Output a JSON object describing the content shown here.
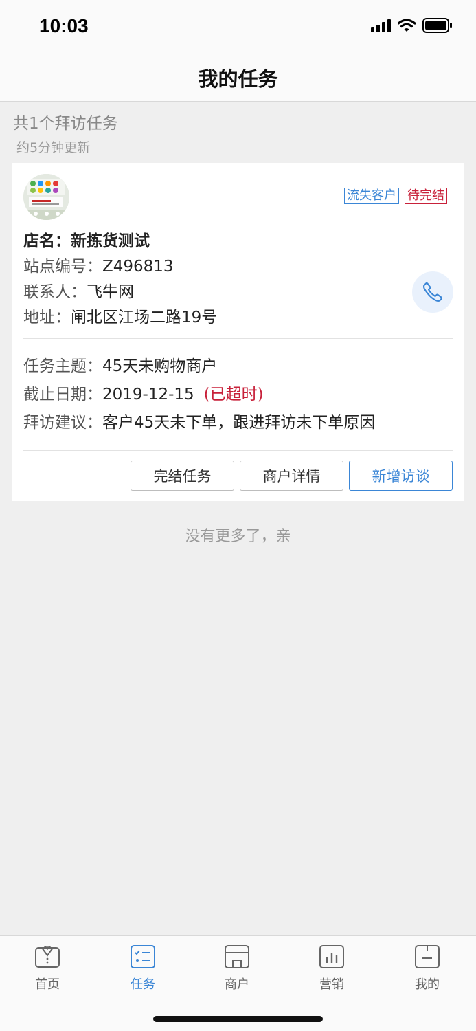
{
  "status_bar": {
    "time": "10:03"
  },
  "nav": {
    "title": "我的任务"
  },
  "summary": {
    "count_text": "共1个拜访任务",
    "updated_text": "约5分钟更新"
  },
  "task_card": {
    "tags": [
      "流失客户",
      "待完结"
    ],
    "store": {
      "name_label": "店名：",
      "name_value": "新拣货测试",
      "site_label": "站点编号：",
      "site_value": "Z496813",
      "contact_label": "联系人：",
      "contact_value": "飞牛网",
      "address_label": "地址：",
      "address_value": "闸北区江场二路19号"
    },
    "task": {
      "topic_label": "任务主题：",
      "topic_value": "45天未购物商户",
      "deadline_label": "截止日期：",
      "deadline_value": "2019-12-15",
      "deadline_status": "(已超时)",
      "advice_label": "拜访建议：",
      "advice_value": "客户45天未下单，跟进拜访未下单原因"
    },
    "actions": {
      "complete": "完结任务",
      "details": "商户详情",
      "add_visit": "新增访谈"
    }
  },
  "end_note": "没有更多了，亲",
  "tab_bar": {
    "items": [
      {
        "label": "首页",
        "icon": "home-icon"
      },
      {
        "label": "任务",
        "icon": "tasks-icon",
        "active": true
      },
      {
        "label": "商户",
        "icon": "store-icon"
      },
      {
        "label": "营销",
        "icon": "chart-icon"
      },
      {
        "label": "我的",
        "icon": "profile-icon"
      }
    ]
  },
  "colors": {
    "accent": "#3b86d6",
    "alert": "#c8213a",
    "background": "#efefef"
  }
}
